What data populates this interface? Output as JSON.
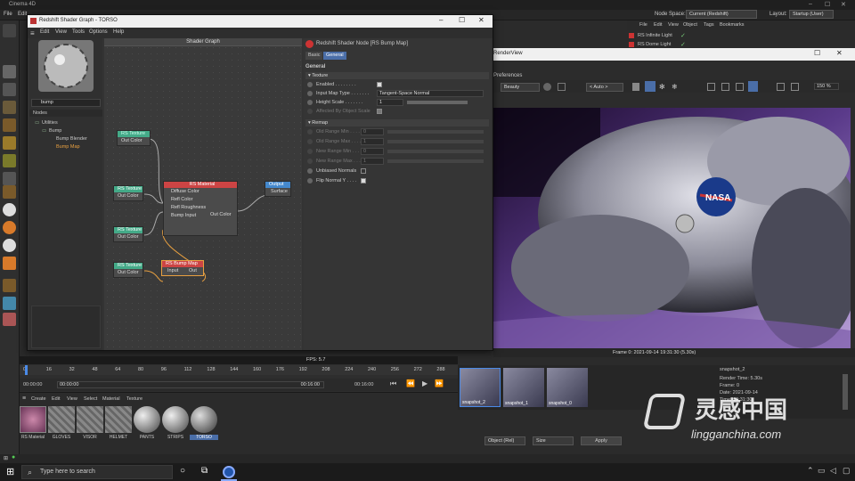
{
  "app": {
    "title": "Cinema 4D",
    "menu": [
      "File",
      "Edit"
    ],
    "node_space_label": "Node Space:",
    "node_space_value": "Current (Redshift)",
    "layout_label": "Layout:",
    "layout_value": "Startup (User)"
  },
  "object_manager": {
    "menu": [
      "File",
      "Edit",
      "View",
      "Object",
      "Tags",
      "Bookmarks"
    ],
    "items": [
      "RS Infinite Light",
      "RS Dome Light"
    ]
  },
  "shader_graph": {
    "title": "Redshift Shader Graph - TORSO",
    "menu": [
      "Edit",
      "View",
      "Tools",
      "Options",
      "Help"
    ],
    "graph_header": "Shader Graph",
    "search_value": "bump",
    "tree_label": "Nodes",
    "tree": [
      "Utilities",
      "Bump",
      "Bump Blender",
      "Bump Map"
    ],
    "nodes": {
      "rs_texture_1": {
        "title": "RS Texture",
        "out": "Out Color"
      },
      "rs_texture_2": {
        "title": "RS Texture",
        "out": "Out Color"
      },
      "rs_texture_3": {
        "title": "RS Texture",
        "out": "Out Color"
      },
      "rs_texture_4": {
        "title": "RS Texture",
        "out": "Out Color"
      },
      "rs_material": {
        "title": "RS Material",
        "inputs": [
          "Diffuse Color",
          "Refl Color",
          "Refl Roughness",
          "Bump Input"
        ],
        "out": "Out Color"
      },
      "output": {
        "title": "Output",
        "in": "Surface"
      },
      "rs_bump_map": {
        "title": "RS Bump Map",
        "in": "Input",
        "out": "Out"
      }
    }
  },
  "properties": {
    "title": "Redshift Shader Node [RS Bump Map]",
    "tabs": [
      "Basic",
      "General"
    ],
    "section_general": "General",
    "section_texture": "Texture",
    "enabled_label": "Enabled . . . . . . . .",
    "input_map_type_label": "Input Map Type . . . . . . .",
    "input_map_type_value": "Tangent-Space Normal",
    "height_scale_label": "Height Scale . . . . . . .",
    "height_scale_value": "1",
    "affected_label": "Affected By Object Scale",
    "section_remap": "Remap",
    "old_range_min_label": "Old Range Min . . . .",
    "old_range_min_value": "0",
    "old_range_max_label": "Old Range Max . . . .",
    "old_range_max_value": "1",
    "new_range_min_label": "New Range Min . . .",
    "new_range_min_value": "0",
    "new_range_max_label": "New Range Max . . .",
    "new_range_max_value": "1",
    "unbiased_label": "Unbiased Normals",
    "flip_normal_label": "Flip Normal Y . . . ."
  },
  "render_view": {
    "title": "RenderView",
    "menu_partial": "Preferences",
    "aov_value": "Beauty",
    "zoom_mode": "< Auto >",
    "zoom_pct": "150 %",
    "frame_info": "Frame  0:  2021-09-14  19:31:30  (5.30s)",
    "fps": "FPS: 5.7"
  },
  "timeline": {
    "ticks": [
      "0",
      "16",
      "32",
      "48",
      "64",
      "80",
      "96",
      "112",
      "128",
      "144",
      "160",
      "176",
      "192",
      "208",
      "224",
      "240",
      "256",
      "272",
      "288"
    ],
    "start": "00:00:00",
    "current": "00:00:00",
    "end": "00:16:00",
    "end2": "00:16:00"
  },
  "material_manager": {
    "menu": [
      "Create",
      "Edit",
      "View",
      "Select",
      "Material",
      "Texture"
    ],
    "materials": [
      "RS Material",
      "GLOVES",
      "VISOR",
      "HELMET",
      "PANTS",
      "STRIPS",
      "TORSO"
    ]
  },
  "snapshots": {
    "items": [
      "snapshot_2",
      "snapshot_1",
      "snapshot_0"
    ],
    "info_title": "snapshot_2",
    "info_lines": [
      "Render Time: 5.30s",
      "Frame: 0",
      "Date: 2021-09-14",
      "Time: 19:31:30"
    ]
  },
  "bottom_attr": {
    "object_value": "Object (Rel)",
    "size_value": "Size",
    "apply_label": "Apply"
  },
  "taskbar": {
    "search_placeholder": "Type here to search"
  },
  "watermark": {
    "cn": "灵感中国",
    "url": "lingganchina.com"
  }
}
